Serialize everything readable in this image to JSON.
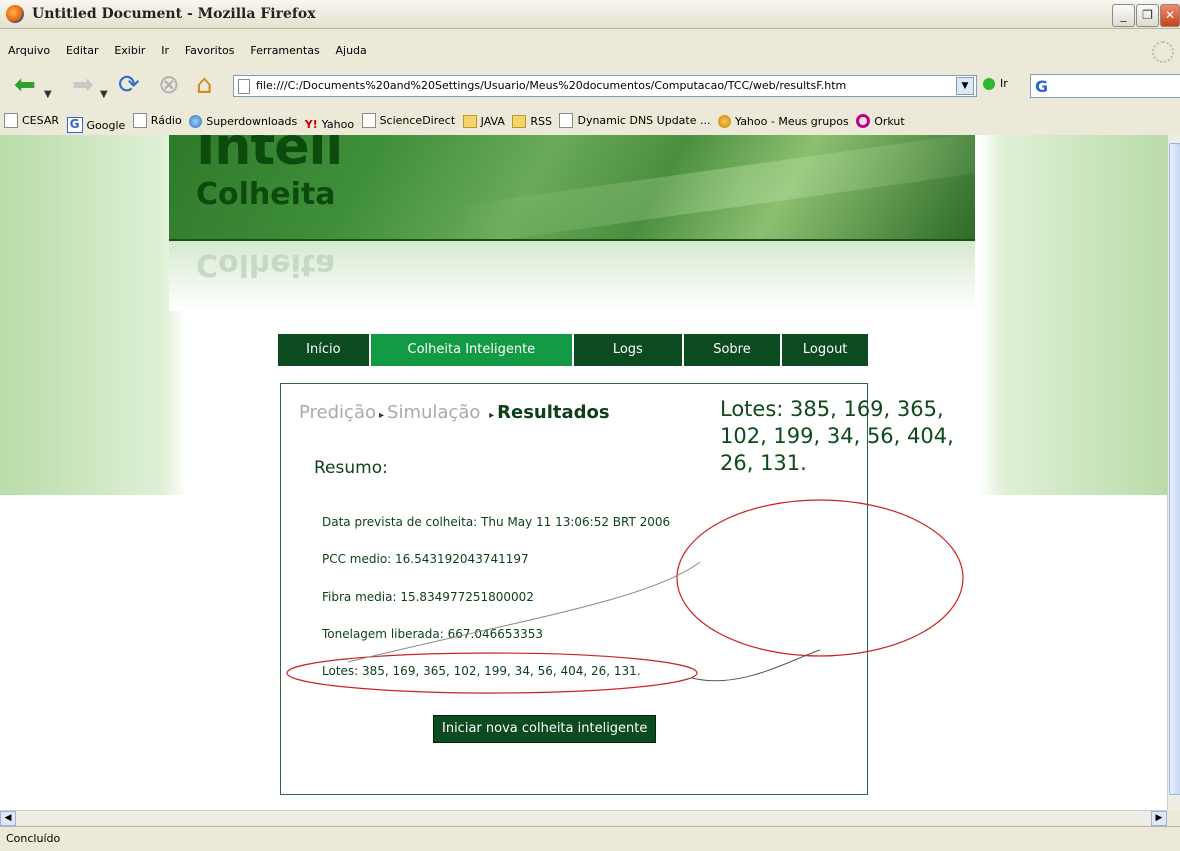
{
  "window": {
    "title": "Untitled Document - Mozilla Firefox",
    "min": "_",
    "max": "❐",
    "close": "✕"
  },
  "menu": [
    "Arquivo",
    "Editar",
    "Exibir",
    "Ir",
    "Favoritos",
    "Ferramentas",
    "Ajuda"
  ],
  "toolbar": {
    "url": "file:///C:/Documents%20and%20Settings/Usuario/Meus%20documentos/Computacao/TCC/web/resultsF.htm",
    "go_label": "Ir"
  },
  "bookmarks": [
    "CESAR",
    "Google",
    "Rádio",
    "Superdownloads",
    "Yahoo",
    "ScienceDirect",
    "JAVA",
    "RSS",
    "Dynamic DNS Update ...",
    "Yahoo - Meus grupos",
    "Orkut"
  ],
  "page": {
    "logo_line1": "Intell",
    "logo_line2": "Colheita",
    "tabs": [
      "Início",
      "Colheita Inteligente",
      "Logs",
      "Sobre",
      "Logout"
    ],
    "active_tab": "Colheita Inteligente",
    "breadcrumb": [
      "Predição",
      "Simulação",
      "Resultados"
    ],
    "summary_heading": "Resumo:",
    "summary_lines": [
      "Data prevista de colheita: Thu May 11 13:06:52 BRT 2006",
      "PCC medio: 16.543192043741197",
      "Fibra media: 15.834977251800002",
      "Tonelagem liberada: 667.046653353",
      "Lotes: 385, 169, 365, 102, 199, 34, 56, 404, 26, 131."
    ],
    "action_button": "Iniciar nova colheita inteligente"
  },
  "annotation": {
    "callout_lines": [
      "Lotes: 385, 169, 365,",
      "102, 199, 34, 56, 404,",
      "26, 131."
    ],
    "color": "#cc2222"
  },
  "status": "Concluído"
}
